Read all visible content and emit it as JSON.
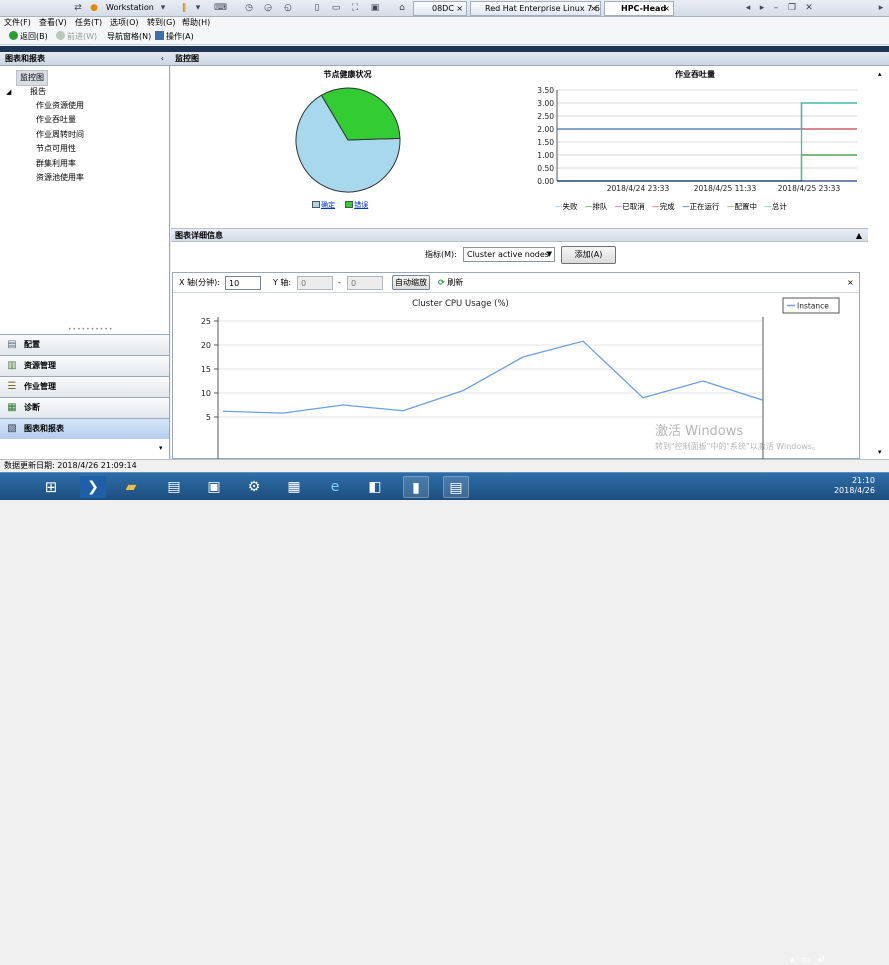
{
  "vmware": {
    "label": "Workstation",
    "tabs": [
      {
        "label": "08DC"
      },
      {
        "label": "Red Hat Enterprise Linux 7 64..."
      },
      {
        "label": "HPC-Head"
      }
    ]
  },
  "menu": [
    "文件(F)",
    "查看(V)",
    "任务(T)",
    "选项(O)",
    "转到(G)",
    "帮助(H)"
  ],
  "toolbar": {
    "back": "返回(B)",
    "forward": "前进(W)",
    "nav_pane": "导航窗格(N)",
    "actions": "操作(A)"
  },
  "nav": {
    "title": "图表和报表",
    "items": [
      "监控图",
      "报告",
      "作业资源使用",
      "作业吞吐量",
      "作业周转时间",
      "节点可用性",
      "群集利用率",
      "资源池使用率"
    ]
  },
  "workspaces": [
    {
      "label": "配置",
      "icon": "config-icon"
    },
    {
      "label": "资源管理",
      "icon": "resource-icon"
    },
    {
      "label": "作业管理",
      "icon": "job-icon"
    },
    {
      "label": "诊断",
      "icon": "diagnostics-icon"
    },
    {
      "label": "图表和报表",
      "icon": "charts-icon"
    }
  ],
  "pane": {
    "title": "监控图",
    "pie_title": "节点健康状况",
    "pie_legend": [
      "确定",
      "错误"
    ],
    "line_title": "作业吞吐量",
    "line_legend": [
      "失败",
      "排队",
      "已取消",
      "完成",
      "正在运行",
      "配置中",
      "总计"
    ],
    "details_title": "图表详细信息",
    "metric_label": "指标(M):",
    "metric_value": "Cluster active nodes",
    "add_button": "添加(A)",
    "x_axis_label": "X 轴(分钟):",
    "x_axis_value": "10",
    "y_axis_label": "Y 轴:",
    "y_min": "0",
    "y_sep": "-",
    "y_max": "0",
    "auto_zoom": "自动缩放",
    "refresh": "刷新"
  },
  "status": "数据更新日期: 2018/4/26 21:09:14",
  "watermark": {
    "line1": "激活 Windows",
    "line2": "转到\"控制面板\"中的\"系统\"以激活 Windows。"
  },
  "clock": {
    "time": "21:10",
    "date": "2018/4/26"
  },
  "colors": {
    "pie_ok": "#a8d8ee",
    "pie_error": "#33cc33",
    "total": "#3cbfa8",
    "failed": "#c04040",
    "done": "#2f7f2f",
    "running": "#3a5f9f",
    "accent": "#1f3553"
  },
  "chart_data": [
    {
      "type": "pie",
      "title": "节点健康状况",
      "labels": [
        "确定",
        "错误"
      ],
      "values": [
        67,
        33
      ]
    },
    {
      "type": "line",
      "title": "作业吞吐量",
      "x": [
        "2018/4/24 23:33",
        "2018/4/25 11:33",
        "2018/4/25 23:33"
      ],
      "ylim": [
        0,
        3.5
      ],
      "yticks": [
        "0.00",
        "0.50",
        "1.00",
        "1.50",
        "2.00",
        "2.50",
        "3.00",
        "3.50"
      ],
      "series": [
        {
          "name": "失败",
          "values": [
            2,
            2,
            2
          ]
        },
        {
          "name": "完成",
          "values": [
            0,
            0,
            1
          ]
        },
        {
          "name": "总计",
          "values": [
            0,
            0,
            3
          ]
        },
        {
          "name": "正在运行",
          "values": [
            0,
            0,
            0
          ]
        }
      ],
      "legend": [
        "失败",
        "排队",
        "已取消",
        "完成",
        "正在运行",
        "配置中",
        "总计"
      ]
    },
    {
      "type": "line",
      "title": "Cluster CPU Usage (%)",
      "ylim": [
        0,
        25
      ],
      "yticks": [
        5,
        10,
        15,
        20,
        25
      ],
      "series": [
        {
          "name": "Instance",
          "values": [
            6.2,
            5.8,
            7.5,
            6.3,
            10.5,
            17.5,
            20.8,
            9.0,
            12.5,
            8.5
          ]
        }
      ]
    }
  ]
}
